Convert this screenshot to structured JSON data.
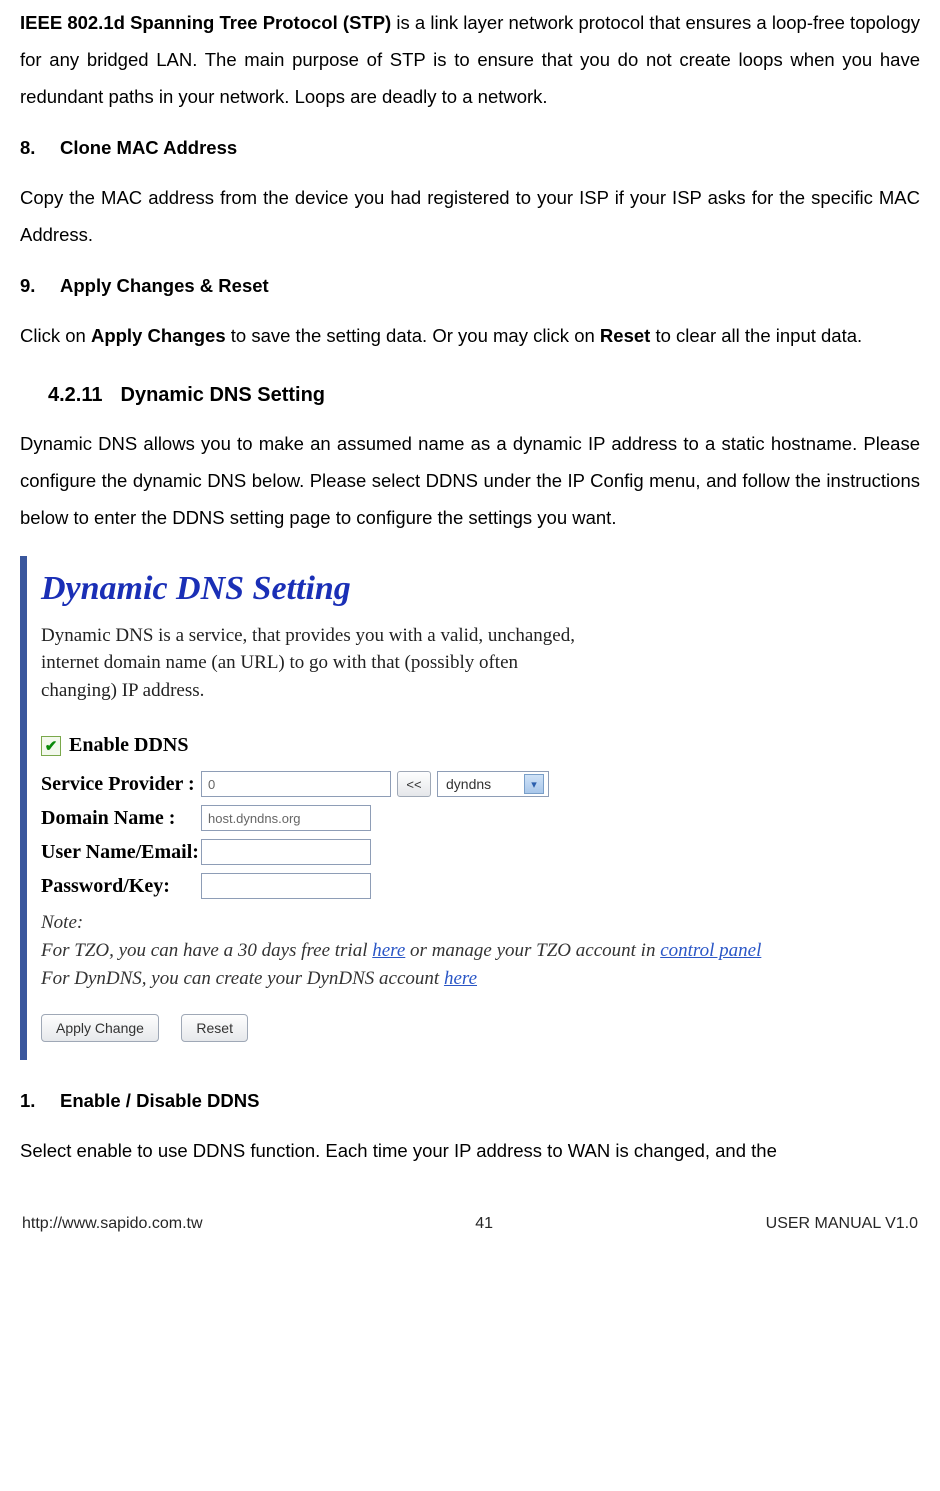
{
  "intro": {
    "stp_bold": "IEEE 802.1d Spanning Tree Protocol (STP)",
    "stp_text": " is a link layer network protocol that ensures a loop-free topology for any bridged LAN. The main purpose of STP is to ensure that you do not create loops when you have redundant paths in your network. Loops are deadly to a network."
  },
  "sec8": {
    "num": "8.",
    "title": "Clone MAC Address",
    "body": "Copy the MAC address from the device you had registered to your ISP if your ISP asks for the specific MAC Address."
  },
  "sec9": {
    "num": "9.",
    "title": "Apply Changes & Reset",
    "pre": "Click on ",
    "b1": "Apply Changes",
    "mid": " to save the setting data. Or you may click on ",
    "b2": "Reset",
    "post": " to clear all the input data."
  },
  "subsection": {
    "num": "4.2.11",
    "title": "Dynamic DNS Setting",
    "body": "Dynamic DNS allows you to make an assumed name as a dynamic IP address to a static hostname. Please configure the dynamic DNS below. Please select DDNS under the IP Config menu, and follow the instructions below to enter the DDNS setting page to configure the settings you want."
  },
  "panel": {
    "title": "Dynamic DNS Setting",
    "intro": "Dynamic DNS is a service, that provides you with a valid, unchanged, internet domain name (an URL) to go with that (possibly often changing) IP address.",
    "check_label": "Enable DDNS",
    "rows": {
      "provider_label": "Service Provider :",
      "provider_value": "0",
      "provider_btn": "<<",
      "provider_select": "dyndns",
      "domain_label": "Domain Name :",
      "domain_value": "host.dyndns.org",
      "user_label": "User Name/Email:",
      "user_value": "",
      "pass_label": "Password/Key:",
      "pass_value": ""
    },
    "note": {
      "title": "Note:",
      "l1a": "For TZO, you can have a 30 days free trial ",
      "l1link": "here",
      "l1b": " or manage your TZO account in ",
      "l1link2": "control panel",
      "l2a": "For DynDNS, you can create your DynDNS account ",
      "l2link": "here"
    },
    "apply_btn": "Apply Change",
    "reset_btn": "Reset"
  },
  "sec1": {
    "num": "1.",
    "title": "Enable / Disable DDNS",
    "body": "Select enable to use DDNS function. Each time your IP address to WAN is changed, and the"
  },
  "footer": {
    "left": "http://www.sapido.com.tw",
    "center": "41",
    "right": "USER MANUAL V1.0"
  }
}
